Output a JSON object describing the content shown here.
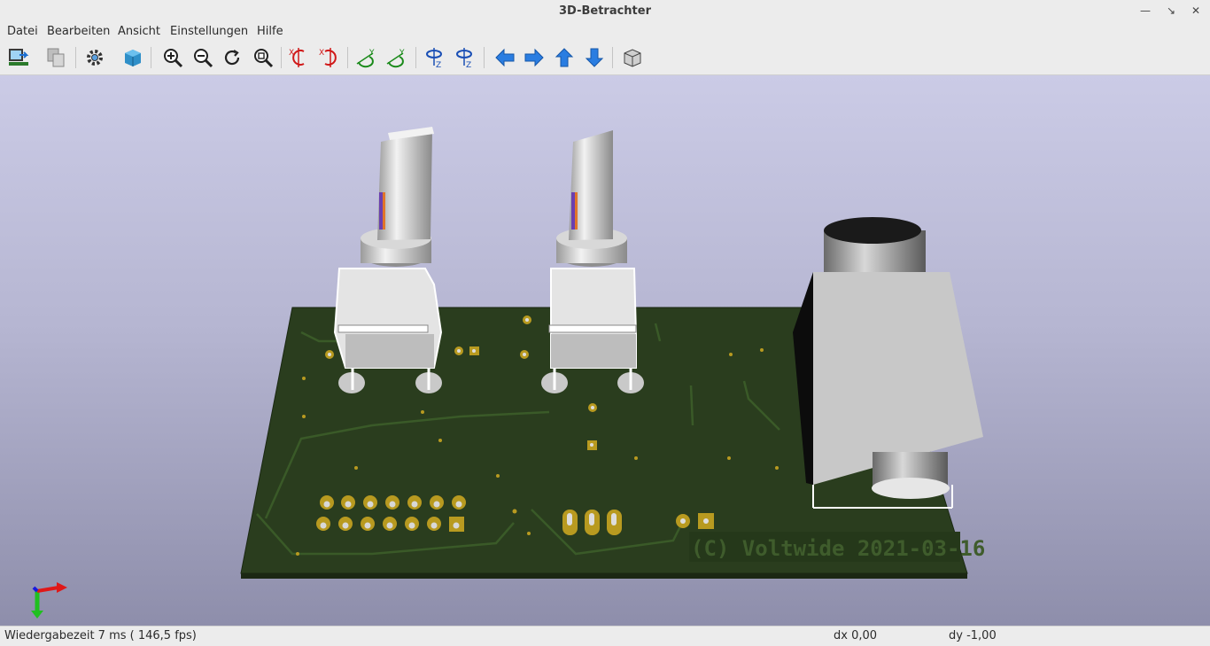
{
  "window": {
    "title": "3D-Betrachter"
  },
  "menu": [
    "Datei",
    "Bearbeiten",
    "Ansicht",
    "Einstellungen",
    "Hilfe"
  ],
  "toolbar": {
    "icons": [
      "reload-board-icon",
      "copy-image-icon",
      "settings-icon",
      "raytracing-icon",
      "zoom-in-icon",
      "zoom-out-icon",
      "redraw-icon",
      "zoom-fit-icon",
      "rotate-x-cw-icon",
      "rotate-x-ccw-icon",
      "rotate-y-cw-icon",
      "rotate-y-ccw-icon",
      "rotate-z-cw-icon",
      "rotate-z-ccw-icon",
      "move-left-icon",
      "move-right-icon",
      "move-up-icon",
      "move-down-icon",
      "orthographic-icon"
    ]
  },
  "board": {
    "silkscreen_text": "(C) Voltwide 2021-03-16"
  },
  "status": {
    "render_time": "Wiedergabezeit 7 ms ( 146,5 fps)",
    "dx": "dx 0,00",
    "dy": "dy -1,00"
  },
  "colors": {
    "pcb": "#2a3d1e",
    "copper_pad": "#b89a20",
    "sky_top": "#cbcbe6",
    "sky_bottom": "#8e8eab"
  }
}
